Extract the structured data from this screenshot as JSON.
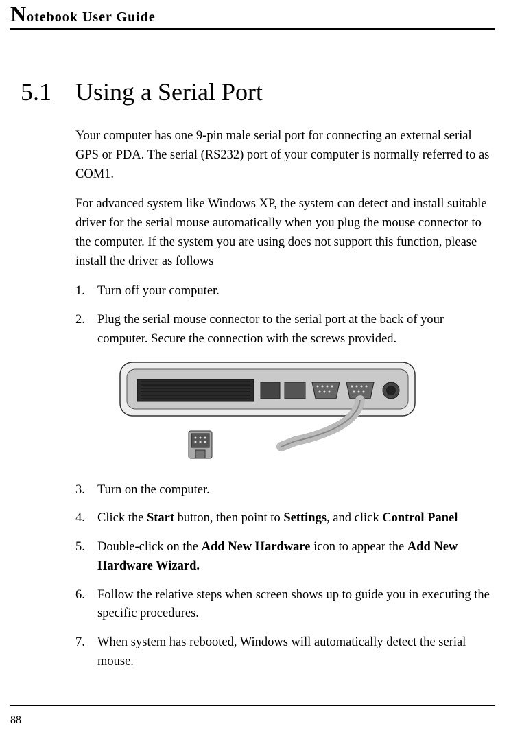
{
  "header": {
    "title_text": "otebook User Guide",
    "big_letter": "N"
  },
  "section": {
    "number": "5.1",
    "title": "Using a Serial Port"
  },
  "paragraphs": {
    "p1": "Your computer has one 9-pin male serial port for connecting an external serial GPS or PDA. The serial (RS232) port of your computer is normally referred to as COM1.",
    "p2": "For advanced system like Windows XP, the system can detect and install suitable driver for the serial mouse automatically when you plug the mouse connector to the computer. If the system you are using does not support this function, please install the driver as follows"
  },
  "steps": {
    "s1": "Turn off your computer.",
    "s2": "Plug the serial mouse connector to the serial port at the back of your computer. Secure the connection with the screws provided.",
    "s3": "Turn on the computer.",
    "s4_a": "Click the ",
    "s4_b": "Start",
    "s4_c": " button, then point to ",
    "s4_d": "Settings",
    "s4_e": ", and click ",
    "s4_f": "Control Panel",
    "s5_a": "Double-click on the ",
    "s5_b": "Add New Hardware",
    "s5_c": " icon to appear the ",
    "s5_d": "Add New Hardware Wizard.",
    "s6": "Follow the relative steps when screen shows up to guide you in executing the specific procedures.",
    "s7": "When system has rebooted, Windows will automatically detect the serial mouse."
  },
  "page_number": "88"
}
